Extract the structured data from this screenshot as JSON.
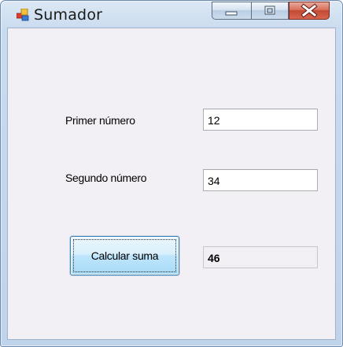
{
  "window": {
    "title": "Sumador",
    "icon": "winforms-app-icon",
    "controls": [
      "minimize-icon",
      "maximize-icon",
      "close-icon"
    ]
  },
  "form": {
    "first_label": "Primer número",
    "first_value": "12",
    "second_label": "Segundo número",
    "second_value": "34",
    "calc_button": "Calcular suma",
    "result_value": "46"
  },
  "colors": {
    "client_bg": "#f3f0f5",
    "close_button": "#c24a34",
    "focused_button_border": "#3c7fb1"
  }
}
